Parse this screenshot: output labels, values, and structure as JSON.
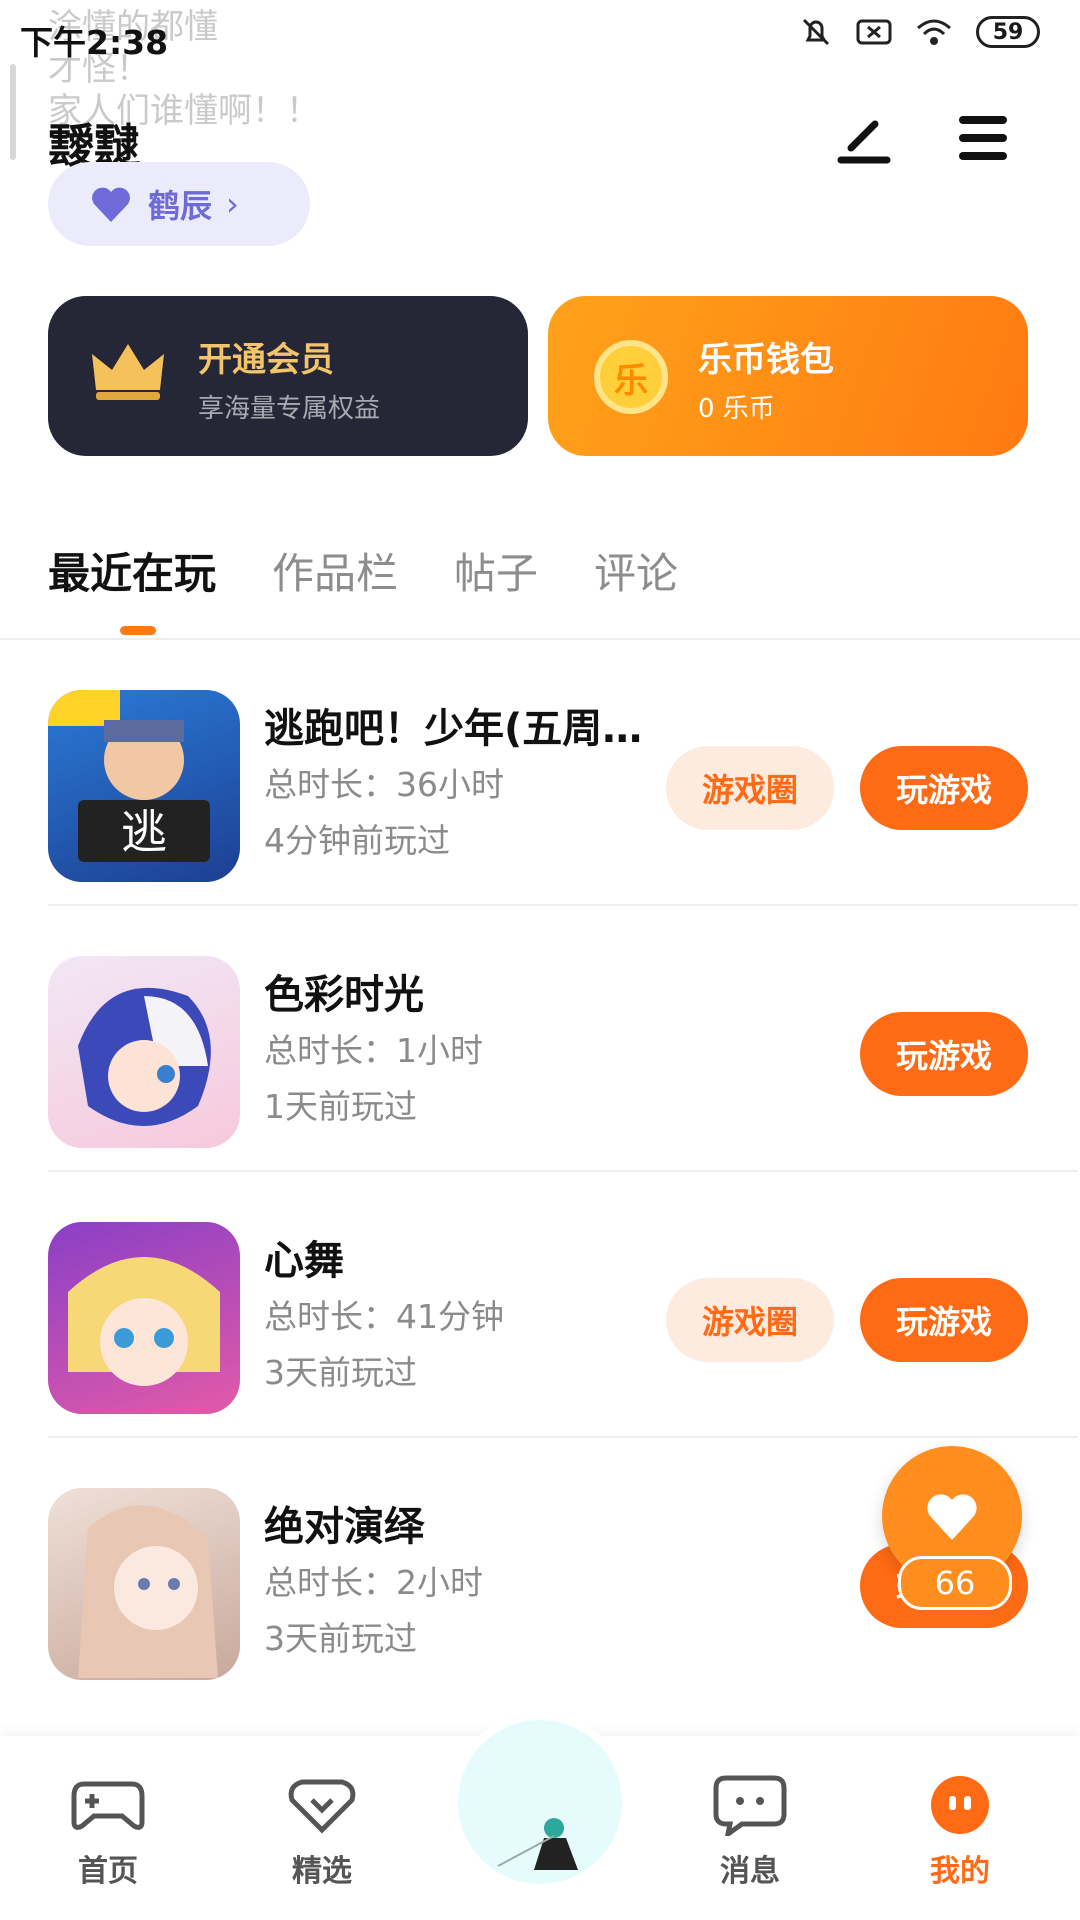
{
  "status_bar": {
    "time": "下午2:38",
    "battery": "59"
  },
  "danmaku": [
    "涂懂的都懂",
    "才怪！",
    "家人们谁懂啊！！"
  ],
  "profile": {
    "username": "靉靆",
    "tag": "鹤辰"
  },
  "cards": {
    "vip": {
      "title": "开通会员",
      "subtitle": "享海量专属权益"
    },
    "wallet": {
      "title": "乐币钱包",
      "subtitle": "0 乐币",
      "coin_glyph": "乐"
    }
  },
  "tabs": [
    "最近在玩",
    "作品栏",
    "帖子",
    "评论"
  ],
  "games": [
    {
      "name": "逃跑吧！少年(五周…",
      "duration": "总时长：36小时",
      "last_played": "4分钟前玩过",
      "circle_label": "游戏圈",
      "play_label": "玩游戏"
    },
    {
      "name": "色彩时光",
      "duration": "总时长：1小时",
      "last_played": "1天前玩过",
      "play_label": "玩游戏"
    },
    {
      "name": "心舞",
      "duration": "总时长：41分钟",
      "last_played": "3天前玩过",
      "circle_label": "游戏圈",
      "play_label": "玩游戏"
    },
    {
      "name": "绝对演绎",
      "duration": "总时长：2小时",
      "last_played": "3天前玩过",
      "play_label": "玩游戏"
    }
  ],
  "like_count": "66",
  "bottom_nav": [
    {
      "label": "首页",
      "icon": "gamepad-icon"
    },
    {
      "label": "精选",
      "icon": "heart-chat-icon"
    },
    {
      "label": "消息",
      "icon": "message-icon"
    },
    {
      "label": "我的",
      "icon": "profile-face-icon"
    }
  ],
  "colors": {
    "accent": "#ff6a14",
    "vip_bg": "#252636",
    "tag_text": "#6e6ad8"
  }
}
